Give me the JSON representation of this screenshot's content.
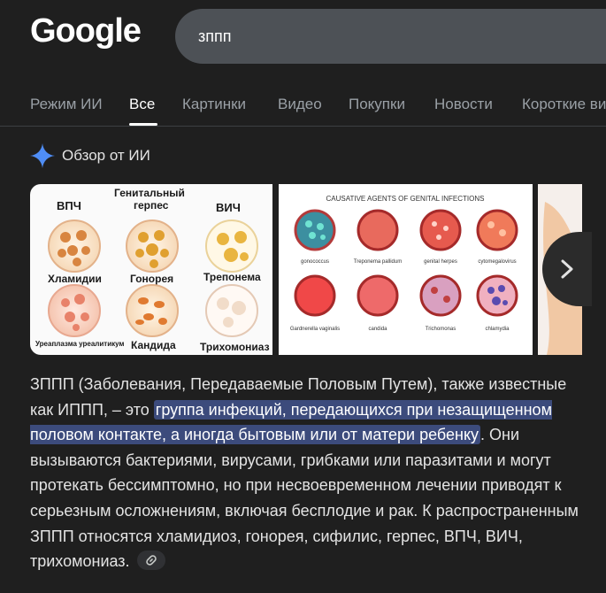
{
  "header": {
    "logo_text": "Google",
    "search_value": "зппп"
  },
  "tabs": [
    {
      "label": "Режим ИИ",
      "active": false
    },
    {
      "label": "Все",
      "active": true
    },
    {
      "label": "Картинки",
      "active": false
    },
    {
      "label": "Видео",
      "active": false
    },
    {
      "label": "Покупки",
      "active": false
    },
    {
      "label": "Новости",
      "active": false
    },
    {
      "label": "Короткие ви",
      "active": false
    }
  ],
  "ai_overview": {
    "title": "Обзор от ИИ",
    "images": {
      "card1": {
        "labels": [
          "ВПЧ",
          "Генитальный",
          "герпес",
          "ВИЧ",
          "Хламидии",
          "Гонорея",
          "Трепонема",
          "Уреаплазма уреалитикум",
          "Кандида",
          "Трихомониаз"
        ]
      },
      "card2": {
        "title": "CAUSATIVE AGENTS OF GENITAL INFECTIONS",
        "labels": [
          "gonococcus",
          "Treponema pallidum",
          "genital herpes",
          "cytomegalovirus",
          "Gardnerella vaginalis",
          "candida",
          "Trichomonas",
          "chlamydia"
        ]
      }
    },
    "text_part1": "ЗППП (Заболевания, Передаваемые Половым Путем), также известные как ИППП, – это ",
    "text_highlight": "группа инфекций, передающихся при незащищенном половом контакте, а иногда бытовым или от матери ребенку",
    "text_part2": ". Они вызываются бактериями, вирусами, грибками или паразитами и могут протекать бессимптомно, но при несвоевременном лечении приводят к серьезным осложнениям, включая бесплодие и рак. К распространенным ЗППП относятся хламидиоз, гонорея, сифилис, герпес, ВПЧ, ВИЧ, трихомониаз."
  },
  "colors": {
    "background": "#1f1f1f",
    "search_box": "#4d5156",
    "highlight": "#3c4b7c",
    "ai_sparkle": "#4f8df5"
  }
}
